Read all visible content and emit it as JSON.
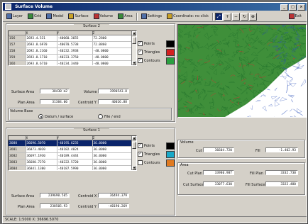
{
  "window": {
    "title": "Surface Volume"
  },
  "toolbar": {
    "items": [
      {
        "label": "Layer",
        "icon": "layer-icon"
      },
      {
        "label": "Grid",
        "icon": "grid-icon"
      },
      {
        "label": "Model",
        "icon": "model-icon"
      },
      {
        "label": "Surface",
        "icon": "surface-icon"
      },
      {
        "label": "Volume",
        "icon": "volume-icon"
      },
      {
        "label": "Area",
        "icon": "area-icon"
      },
      {
        "label": "Settings",
        "icon": "settings-icon"
      },
      {
        "label": "Coordinate: no click",
        "icon": "coordinate-icon"
      }
    ],
    "zoom_tools": [
      "⤢",
      "+",
      "−",
      "↻",
      "⊕"
    ],
    "exit_label": "Exit"
  },
  "surface2": {
    "header": "Surface 2",
    "columns": [
      "",
      "X",
      "Y",
      "Z"
    ],
    "rows": [
      [
        "156",
        "2693.4.531",
        "-40060.3655",
        "72.2800"
      ],
      [
        "157",
        "2693.8.6970",
        "-40070.5738",
        "72.0860"
      ],
      [
        "158",
        "2692.8.2160",
        "-40232.3938",
        "-48.0800"
      ],
      [
        "159",
        "2693.8.1710",
        "-40233.3750",
        "-48.0800"
      ],
      [
        "160",
        "2693.8.6710",
        "-40234.3440",
        "-48.0800"
      ]
    ],
    "checks": [
      {
        "label": "Points",
        "checked": true,
        "color": "#000000"
      },
      {
        "label": "Triangles",
        "checked": true,
        "color": "#d42020"
      },
      {
        "label": "Contours",
        "checked": true,
        "color": "#2aa040"
      }
    ],
    "fields": {
      "surface_area_label": "Surface Area",
      "surface_area": "38430 m2",
      "vol_label": "Volume",
      "vol": "3990543.8",
      "plan_area_label": "Plan Area",
      "plan_area": "31384.00",
      "centroid_label": "Centroid Y",
      "centroid": "40026.88"
    },
    "volume_base": {
      "label": "Volume Base",
      "options": [
        {
          "label": "Datum / surface",
          "selected": true
        },
        {
          "label": "File / end",
          "selected": false
        }
      ]
    }
  },
  "surface1": {
    "header": "Surface 1",
    "columns": [
      "",
      "X",
      "Y",
      "Z"
    ],
    "rows": [
      [
        "3080",
        "36696.5070",
        "-40195.6235",
        "36.0000"
      ],
      [
        "3081",
        "36873.4020",
        "-40182.4024",
        "36.0000"
      ],
      [
        "3082",
        "36697.1930",
        "-40189.4444",
        "36.0000"
      ],
      [
        "3083",
        "36680.7270",
        "-40222.5720",
        "36.0000"
      ],
      [
        "3084",
        "36841.1300",
        "-40187.5990",
        "36.0000"
      ]
    ],
    "selected_row": 0,
    "checks": [
      {
        "label": "Points",
        "checked": true,
        "color": "#000000"
      },
      {
        "label": "Triangles",
        "checked": true,
        "color": "#18a8c8"
      },
      {
        "label": "Contours",
        "checked": false,
        "color": "#e07a20"
      }
    ],
    "fields": {
      "surface_area_label": "Surface Area",
      "surface_area": "239690.565",
      "centroid_x_label": "Centroid X",
      "centroid_x": "36494.379",
      "plan_area_label": "Plan Area",
      "plan_area": "238505.93",
      "centroid_y_label": "Centroid Y",
      "centroid_y": "-40190.269"
    }
  },
  "volume_panel": {
    "header": "Volume",
    "cut_label": "Cut",
    "cut": "36604.720",
    "fill_label": "Fill",
    "fill": "-1.402.93"
  },
  "area_panel": {
    "header": "Area",
    "cut_plan_label": "Cut Plan",
    "cut_plan": "33980.987",
    "fill_plan_label": "Fill Plan",
    "fill_plan": "3332.730",
    "cut_surface_label": "Cut Surface",
    "cut_surface": "33077.630",
    "fill_surface_label": "Fill Surface",
    "fill_surface": "3322.480"
  },
  "status": {
    "text": "SCALE: 1:5000  X: 36696.5070"
  },
  "colors": {
    "accent": "#0a246a",
    "window": "#d4d0c8"
  }
}
